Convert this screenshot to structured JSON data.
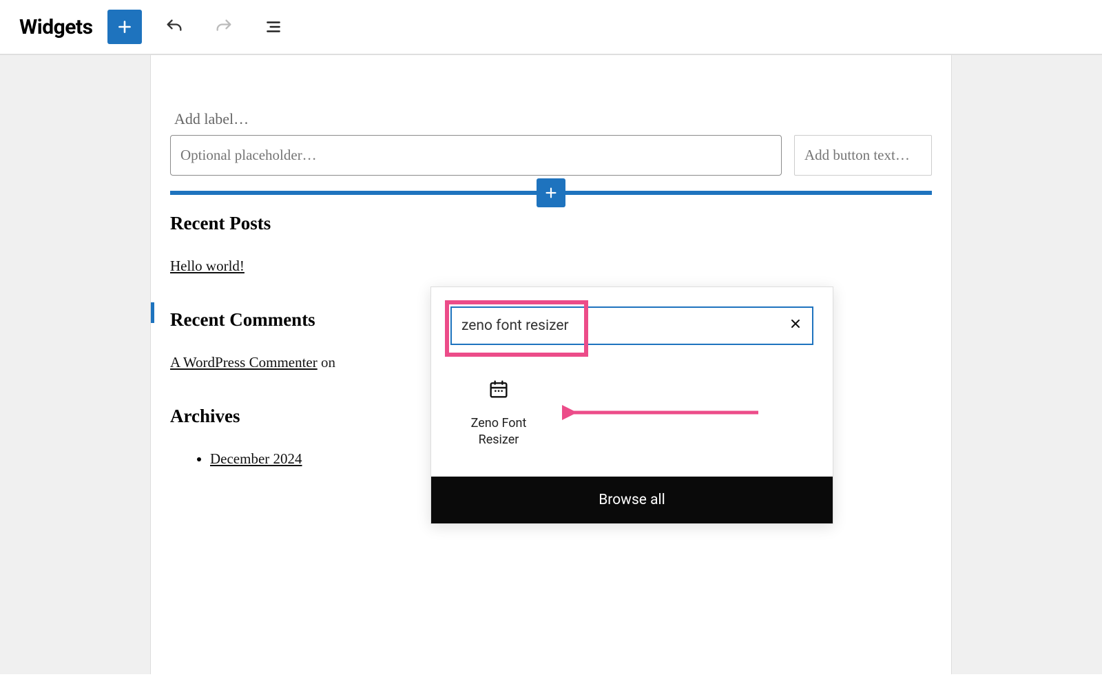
{
  "header": {
    "title": "Widgets"
  },
  "form": {
    "label_placeholder": "Add label…",
    "main_placeholder": "Optional placeholder…",
    "button_placeholder": "Add button text…"
  },
  "widgets": {
    "recent_posts": {
      "heading": "Recent Posts",
      "items": [
        "Hello world!"
      ]
    },
    "recent_comments": {
      "heading": "Recent Comments",
      "comment_author": "A WordPress Commenter",
      "comment_on": " on"
    },
    "archives": {
      "heading": "Archives",
      "items": [
        "December 2024"
      ]
    }
  },
  "inserter": {
    "search_value": "zeno font resizer",
    "result_label": "Zeno Font Resizer",
    "browse_all": "Browse all"
  }
}
